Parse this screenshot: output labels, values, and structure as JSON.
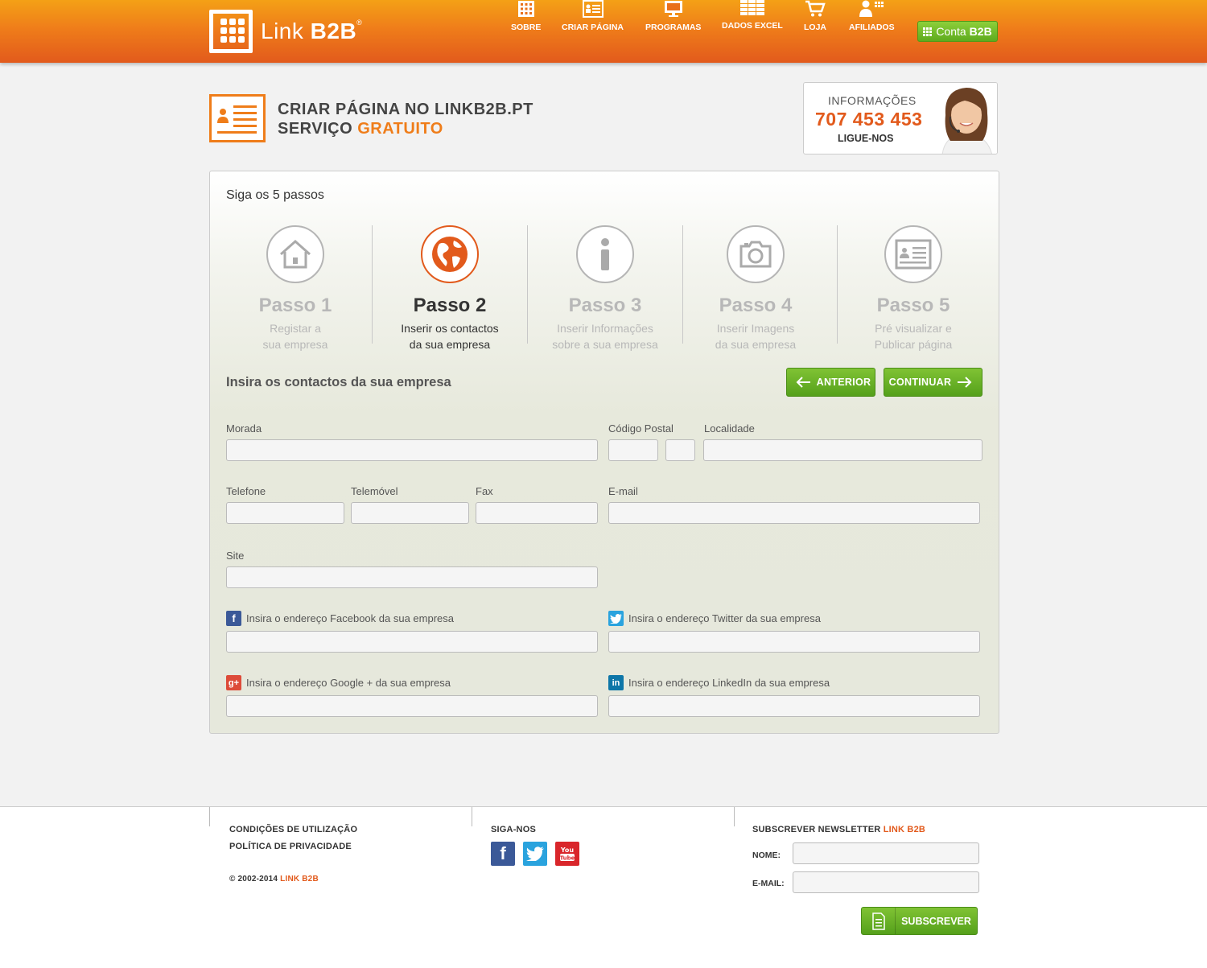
{
  "brand": {
    "name_light": "Link ",
    "name_bold": "B2B",
    "reg": "®"
  },
  "nav": [
    {
      "label": "SOBRE",
      "icon": "building-icon"
    },
    {
      "label": "CRIAR PÁGINA",
      "icon": "id-card-icon"
    },
    {
      "label": "PROGRAMAS",
      "icon": "monitor-icon"
    },
    {
      "label": "DADOS EXCEL",
      "icon": "spreadsheet-icon"
    },
    {
      "label": "LOJA",
      "icon": "cart-icon"
    },
    {
      "label": "AFILIADOS",
      "icon": "users-grid-icon"
    }
  ],
  "account_button": {
    "light": "Conta",
    "bold": "B2B"
  },
  "page_title": {
    "line1": "CRIAR PÁGINA NO LINKB2B.PT",
    "line2_prefix": "SERVIÇO ",
    "line2_highlight": "GRATUITO"
  },
  "info": {
    "label": "INFORMAÇÕES",
    "phone": "707 453 453",
    "cta": "LIGUE-NOS"
  },
  "steps_title": "Siga os 5 passos",
  "steps": [
    {
      "title": "Passo 1",
      "desc1": "Registar a",
      "desc2": "sua empresa",
      "icon": "house-icon"
    },
    {
      "title": "Passo 2",
      "desc1": "Inserir os contactos",
      "desc2": "da sua empresa",
      "icon": "globe-icon"
    },
    {
      "title": "Passo 3",
      "desc1": "Inserir Informações",
      "desc2": "sobre a sua empresa",
      "icon": "info-icon"
    },
    {
      "title": "Passo 4",
      "desc1": "Inserir Imagens",
      "desc2": "da sua empresa",
      "icon": "camera-icon"
    },
    {
      "title": "Passo 5",
      "desc1": "Pré visualizar e",
      "desc2": "Publicar página",
      "icon": "id-card-icon"
    }
  ],
  "active_step": 2,
  "form": {
    "title": "Insira os contactos da sua empresa",
    "prev_label": "ANTERIOR",
    "next_label": "CONTINUAR",
    "labels": {
      "morada": "Morada",
      "codigo_postal": "Código Postal",
      "localidade": "Localidade",
      "telefone": "Telefone",
      "telemovel": "Telemóvel",
      "fax": "Fax",
      "email": "E-mail",
      "site": "Site",
      "facebook": "Insira o endereço Facebook da sua empresa",
      "twitter": "Insira o endereço Twitter da sua empresa",
      "google": "Insira o endereço Google + da sua empresa",
      "linkedin": "Insira o endereço LinkedIn da sua empresa"
    }
  },
  "footer": {
    "terms": "CONDIÇÕES DE UTILIZAÇÃO",
    "privacy": "POLÍTICA DE PRIVACIDADE",
    "copyright_prefix": "© 2002-2014 ",
    "copyright_brand": "LINK B2B",
    "follow": "SIGA-NOS",
    "newsletter_prefix": "SUBSCREVER NEWSLETTER ",
    "newsletter_brand": "LINK B2B",
    "name_label": "NOME:",
    "email_label": "E-MAIL:",
    "subscribe": "SUBSCREVER"
  },
  "colors": {
    "orange": "#ef7d1a",
    "green": "#5eab1e",
    "facebook": "#3b5998",
    "twitter": "#2aa3de",
    "youtube": "#d9262b",
    "google": "#dd4b39",
    "linkedin": "#0e76a8"
  }
}
